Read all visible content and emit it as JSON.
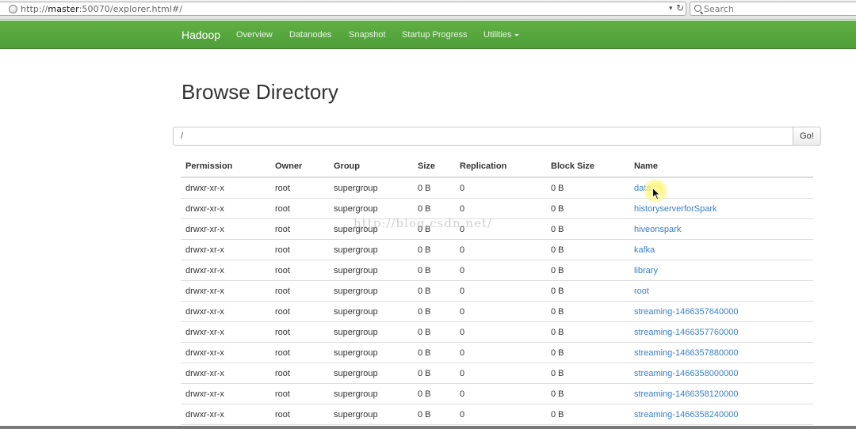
{
  "browser": {
    "url_prefix": "http://",
    "url_host": "master",
    "url_rest": ":50070/explorer.html#/",
    "search_placeholder": "Search",
    "dropdown_glyph": "▾",
    "reload_glyph": "↻"
  },
  "navbar": {
    "brand": "Hadoop",
    "links": [
      "Overview",
      "Datanodes",
      "Snapshot",
      "Startup Progress",
      "Utilities"
    ],
    "colors": {
      "background": "#56a83e",
      "text": "#ffffff"
    }
  },
  "page": {
    "title": "Browse Directory",
    "path_value": "/",
    "go_label": "Go!"
  },
  "table": {
    "headers": [
      "Permission",
      "Owner",
      "Group",
      "Size",
      "Replication",
      "Block Size",
      "Name"
    ],
    "rows": [
      [
        "drwxr-xr-x",
        "root",
        "supergroup",
        "0 B",
        "0",
        "0 B",
        "data"
      ],
      [
        "drwxr-xr-x",
        "root",
        "supergroup",
        "0 B",
        "0",
        "0 B",
        "historyserverforSpark"
      ],
      [
        "drwxr-xr-x",
        "root",
        "supergroup",
        "0 B",
        "0",
        "0 B",
        "hiveonspark"
      ],
      [
        "drwxr-xr-x",
        "root",
        "supergroup",
        "0 B",
        "0",
        "0 B",
        "kafka"
      ],
      [
        "drwxr-xr-x",
        "root",
        "supergroup",
        "0 B",
        "0",
        "0 B",
        "library"
      ],
      [
        "drwxr-xr-x",
        "root",
        "supergroup",
        "0 B",
        "0",
        "0 B",
        "root"
      ],
      [
        "drwxr-xr-x",
        "root",
        "supergroup",
        "0 B",
        "0",
        "0 B",
        "streaming-1466357640000"
      ],
      [
        "drwxr-xr-x",
        "root",
        "supergroup",
        "0 B",
        "0",
        "0 B",
        "streaming-1466357760000"
      ],
      [
        "drwxr-xr-x",
        "root",
        "supergroup",
        "0 B",
        "0",
        "0 B",
        "streaming-1466357880000"
      ],
      [
        "drwxr-xr-x",
        "root",
        "supergroup",
        "0 B",
        "0",
        "0 B",
        "streaming-1466358000000"
      ],
      [
        "drwxr-xr-x",
        "root",
        "supergroup",
        "0 B",
        "0",
        "0 B",
        "streaming-1466358120000"
      ],
      [
        "drwxr-xr-x",
        "root",
        "supergroup",
        "0 B",
        "0",
        "0 B",
        "streaming-1466358240000"
      ]
    ],
    "link_color": "#3a7fc4"
  },
  "watermark": "http://blog.csdn.net/"
}
